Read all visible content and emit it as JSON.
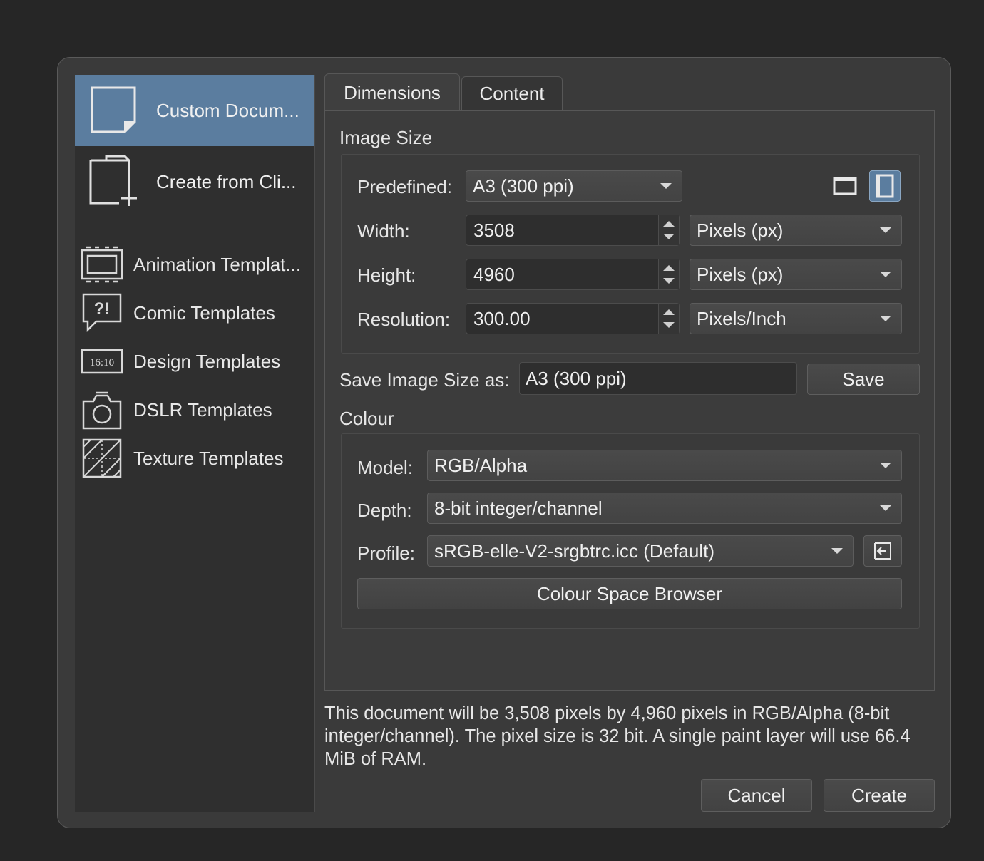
{
  "sidebar": {
    "items": [
      {
        "label": "Custom Docum...",
        "icon": "blank-document-icon",
        "selected": true
      },
      {
        "label": "Create from Cli...",
        "icon": "clipboard-new-icon",
        "selected": false
      },
      {
        "label": "Animation Templat...",
        "icon": "animation-template-icon"
      },
      {
        "label": "Comic Templates",
        "icon": "comic-speech-icon"
      },
      {
        "label": "Design Templates",
        "icon": "design-aspect-ratio-icon",
        "icon_text": "16:10"
      },
      {
        "label": "DSLR Templates",
        "icon": "camera-icon"
      },
      {
        "label": "Texture Templates",
        "icon": "texture-icon"
      }
    ]
  },
  "tabs": {
    "dimensions": "Dimensions",
    "content": "Content"
  },
  "image_size": {
    "title": "Image Size",
    "predefined_label": "Predefined:",
    "predefined_value": "A3 (300 ppi)",
    "width_label": "Width:",
    "width_value": "3508",
    "width_unit": "Pixels (px)",
    "height_label": "Height:",
    "height_value": "4960",
    "height_unit": "Pixels (px)",
    "resolution_label": "Resolution:",
    "resolution_value": "300.00",
    "resolution_unit": "Pixels/Inch",
    "orientation": "portrait"
  },
  "save_size": {
    "label": "Save Image Size as:",
    "value": "A3 (300 ppi)",
    "button": "Save"
  },
  "colour": {
    "title": "Colour",
    "model_label": "Model:",
    "model_value": "RGB/Alpha",
    "depth_label": "Depth:",
    "depth_value": "8-bit integer/channel",
    "profile_label": "Profile:",
    "profile_value": "sRGB-elle-V2-srgbtrc.icc (Default)",
    "browser_button": "Colour Space Browser"
  },
  "summary": "This document will be 3,508 pixels by 4,960 pixels in RGB/Alpha (8-bit integer/channel). The pixel size is 32 bit. A single paint layer will use 66.4 MiB of RAM.",
  "footer": {
    "cancel": "Cancel",
    "create": "Create"
  },
  "colors": {
    "accent": "#5b7d9f",
    "background": "#3a3a3a"
  }
}
